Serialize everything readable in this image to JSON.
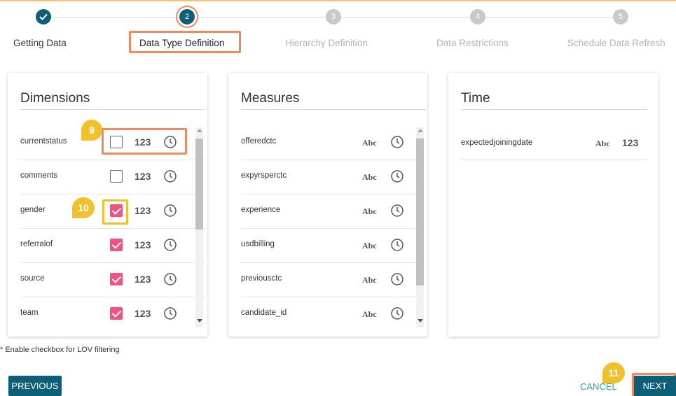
{
  "stepper": {
    "steps": [
      {
        "number": "",
        "label": "Getting Data",
        "state": "done"
      },
      {
        "number": "2",
        "label": "Data Type Definition",
        "state": "active"
      },
      {
        "number": "3",
        "label": "Hierarchy Definition",
        "state": "todo"
      },
      {
        "number": "4",
        "label": "Data Restrictions",
        "state": "todo"
      },
      {
        "number": "5",
        "label": "Schedule Data Refresh",
        "state": "todo"
      }
    ]
  },
  "dimensions": {
    "title": "Dimensions",
    "rows": [
      {
        "label": "currentstatus",
        "checked": false,
        "num": "123"
      },
      {
        "label": "comments",
        "checked": false,
        "num": "123"
      },
      {
        "label": "gender",
        "checked": true,
        "num": "123"
      },
      {
        "label": "referralof",
        "checked": true,
        "num": "123"
      },
      {
        "label": "source",
        "checked": true,
        "num": "123"
      },
      {
        "label": "team",
        "checked": true,
        "num": "123"
      }
    ]
  },
  "measures": {
    "title": "Measures",
    "rows": [
      {
        "label": "offeredctc",
        "abc": "Abc"
      },
      {
        "label": "expyrsperctc",
        "abc": "Abc"
      },
      {
        "label": "experience",
        "abc": "Abc"
      },
      {
        "label": "usdbilling",
        "abc": "Abc"
      },
      {
        "label": "previousctc",
        "abc": "Abc"
      },
      {
        "label": "candidate_id",
        "abc": "Abc"
      }
    ]
  },
  "time": {
    "title": "Time",
    "rows": [
      {
        "label": "expectedjoiningdate",
        "abc": "Abc",
        "num": "123"
      }
    ]
  },
  "callouts": {
    "c9": "9",
    "c10": "10",
    "c11": "11"
  },
  "footer": {
    "note": "* Enable checkbox for LOV filtering",
    "previous": "PREVIOUS",
    "cancel": "CANCEL",
    "next": "NEXT"
  },
  "colors": {
    "primary": "#0d5f78",
    "checkbox_checked": "#f2527f",
    "highlight_orange": "#f08a5d",
    "highlight_yellow": "#f0c12c",
    "cancel_text": "#2aa6a4"
  }
}
